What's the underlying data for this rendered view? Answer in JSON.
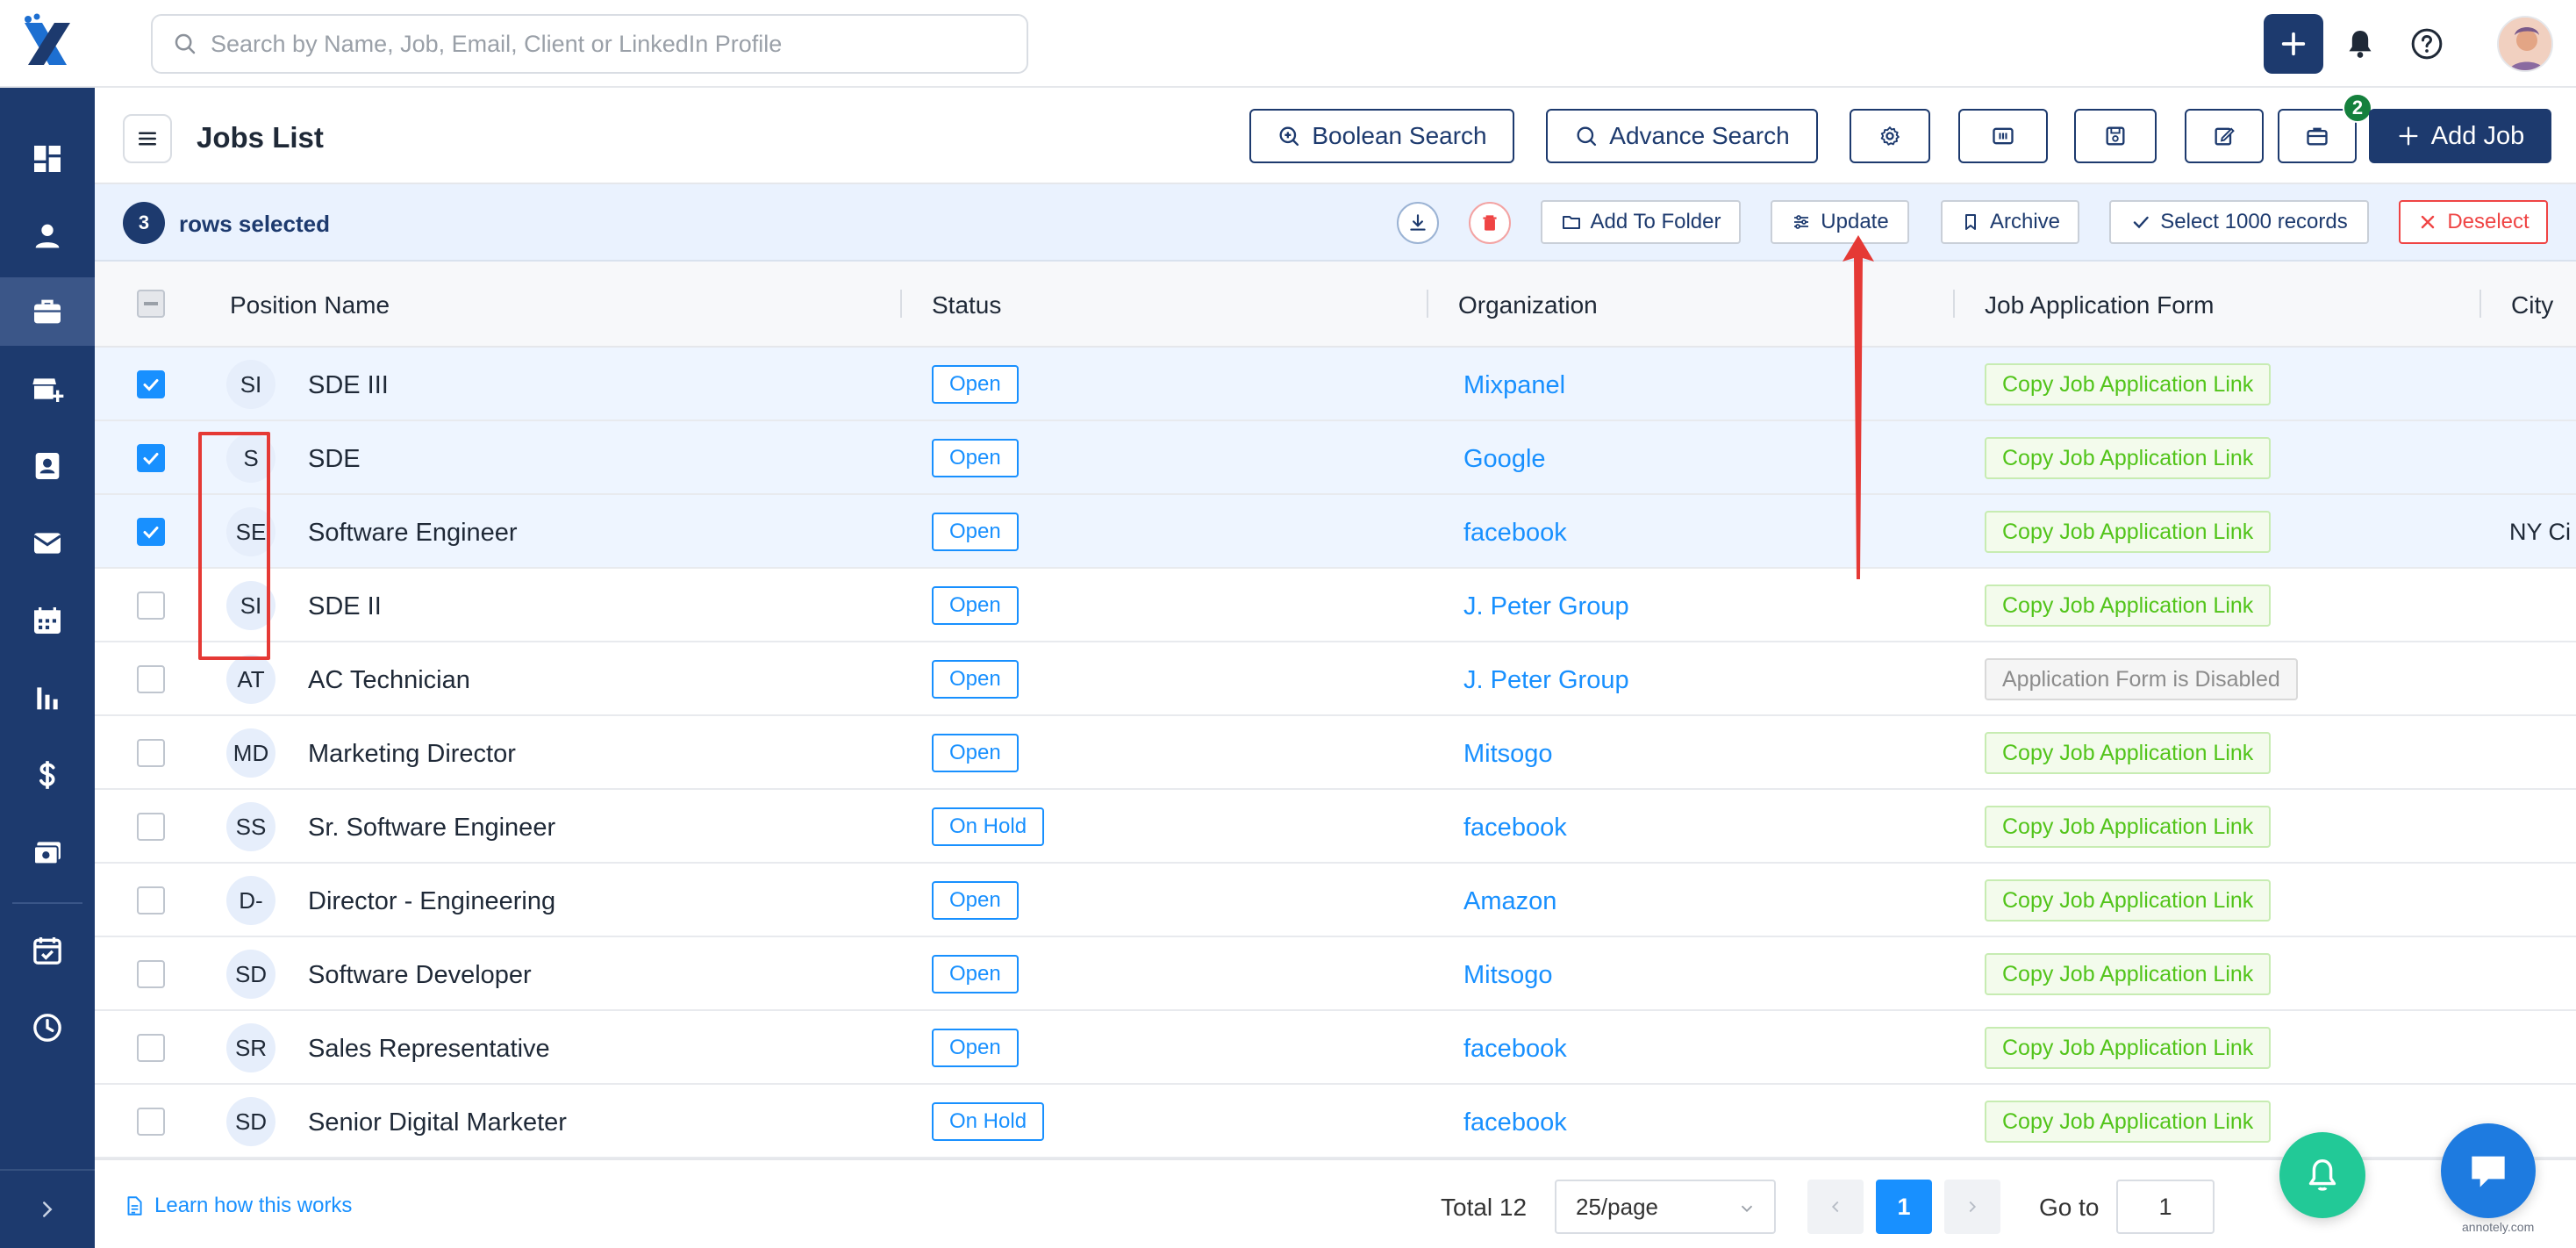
{
  "search": {
    "placeholder": "Search by Name, Job, Email, Client or LinkedIn Profile"
  },
  "header": {
    "title": "Jobs List",
    "boolean_search": "Boolean Search",
    "advance_search": "Advance Search",
    "add_job": "Add Job",
    "badge_count": "2"
  },
  "selection": {
    "count": "3",
    "text": "rows selected",
    "add_to_folder": "Add To Folder",
    "update": "Update",
    "archive": "Archive",
    "select_all": "Select 1000 records",
    "deselect": "Deselect"
  },
  "columns": {
    "position": "Position Name",
    "status": "Status",
    "organization": "Organization",
    "form": "Job Application Form",
    "city": "City"
  },
  "rows": [
    {
      "initials": "SI",
      "name": "SDE III",
      "status": "Open",
      "org": "Mixpanel",
      "form": "Copy Job Application Link",
      "city": "",
      "selected": true
    },
    {
      "initials": "S",
      "name": "SDE",
      "status": "Open",
      "org": "Google",
      "form": "Copy Job Application Link",
      "city": "",
      "selected": true
    },
    {
      "initials": "SE",
      "name": "Software Engineer",
      "status": "Open",
      "org": "facebook",
      "form": "Copy Job Application Link",
      "city": "NY Ci",
      "selected": true
    },
    {
      "initials": "SI",
      "name": "SDE II",
      "status": "Open",
      "org": "J. Peter Group",
      "form": "Copy Job Application Link",
      "city": "",
      "selected": false
    },
    {
      "initials": "AT",
      "name": "AC Technician",
      "status": "Open",
      "org": "J. Peter Group",
      "form": "Application Form is Disabled",
      "city": "",
      "selected": false
    },
    {
      "initials": "MD",
      "name": "Marketing Director",
      "status": "Open",
      "org": "Mitsogo",
      "form": "Copy Job Application Link",
      "city": "",
      "selected": false
    },
    {
      "initials": "SS",
      "name": "Sr. Software Engineer",
      "status": "On Hold",
      "org": "facebook",
      "form": "Copy Job Application Link",
      "city": "",
      "selected": false
    },
    {
      "initials": "D-",
      "name": "Director - Engineering",
      "status": "Open",
      "org": "Amazon",
      "form": "Copy Job Application Link",
      "city": "",
      "selected": false
    },
    {
      "initials": "SD",
      "name": "Software Developer",
      "status": "Open",
      "org": "Mitsogo",
      "form": "Copy Job Application Link",
      "city": "",
      "selected": false
    },
    {
      "initials": "SR",
      "name": "Sales Representative",
      "status": "Open",
      "org": "facebook",
      "form": "Copy Job Application Link",
      "city": "",
      "selected": false
    },
    {
      "initials": "SD",
      "name": "Senior Digital Marketer",
      "status": "On Hold",
      "org": "facebook",
      "form": "Copy Job Application Link",
      "city": "",
      "selected": false
    }
  ],
  "footer": {
    "learn": "Learn how this works",
    "total": "Total 12",
    "page_size": "25/page",
    "current_page": "1",
    "goto_label": "Go to",
    "goto_value": "1"
  },
  "watermark": "annotely.com",
  "sidebar_icons": [
    "dashboard-icon",
    "person-icon",
    "briefcase-icon",
    "store-add-icon",
    "contact-card-icon",
    "mail-icon",
    "calendar-icon",
    "bar-chart-icon",
    "dollar-icon",
    "money-icon",
    "task-calendar-icon",
    "clock-icon"
  ],
  "colors": {
    "brand": "#1d3a6e",
    "accent": "#1890ff",
    "success": "#52c41a",
    "danger": "#ef4444"
  }
}
